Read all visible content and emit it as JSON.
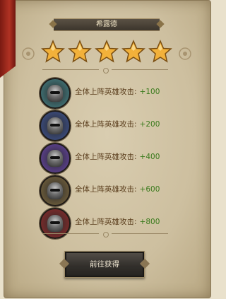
{
  "dialog": {
    "title": "希露德",
    "star_count": 5,
    "bonuses": [
      {
        "label": "全体上阵英雄攻击:",
        "value": "+100",
        "ring_color": "#3f6f72"
      },
      {
        "label": "全体上阵英雄攻击:",
        "value": "+200",
        "ring_color": "#3a4a7a"
      },
      {
        "label": "全体上阵英雄攻击:",
        "value": "+400",
        "ring_color": "#5a3f8a"
      },
      {
        "label": "全体上阵英雄攻击:",
        "value": "+600",
        "ring_color": "#6a5a3a"
      },
      {
        "label": "全体上阵英雄攻击:",
        "value": "+800",
        "ring_color": "#7a2a2a"
      }
    ],
    "action_button": "前往获得"
  },
  "colors": {
    "bonus_value": "#3a7a1c",
    "bonus_label": "#5a3d1c",
    "star_gold": "#f2b13a"
  },
  "icons": [
    "star-icon",
    "helmet-icon",
    "flourish-icon"
  ]
}
